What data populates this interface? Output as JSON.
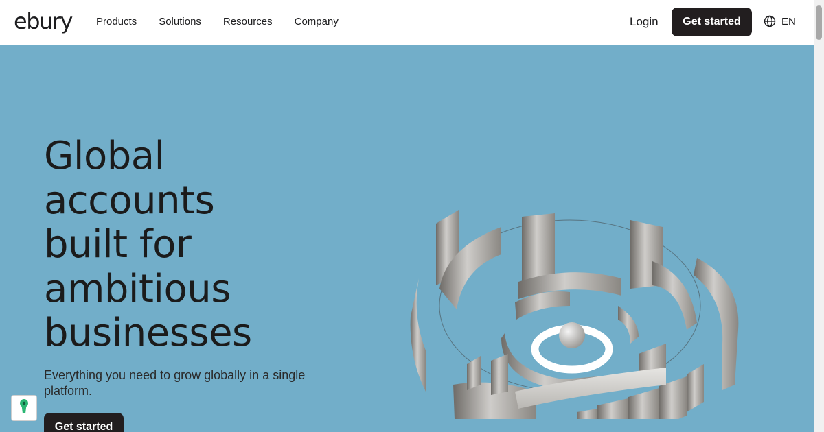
{
  "header": {
    "logo": "ebury",
    "nav": [
      "Products",
      "Solutions",
      "Resources",
      "Company"
    ],
    "login": "Login",
    "cta": "Get started",
    "language": "EN",
    "language_icon": "globe-icon"
  },
  "hero": {
    "headline_lines": [
      "Global",
      "accounts",
      "built for",
      "ambitious",
      "businesses"
    ],
    "subtext": "Everything you need to grow globally in a single platform.",
    "cta": "Get started",
    "illustration": "metallic-circular-maze-illustration"
  },
  "cookie_widget": {
    "icon": "keyhole-icon"
  },
  "colors": {
    "hero_bg": "#72aec9",
    "button_bg": "#221e1f",
    "cookie_icon": "#2bb673"
  }
}
